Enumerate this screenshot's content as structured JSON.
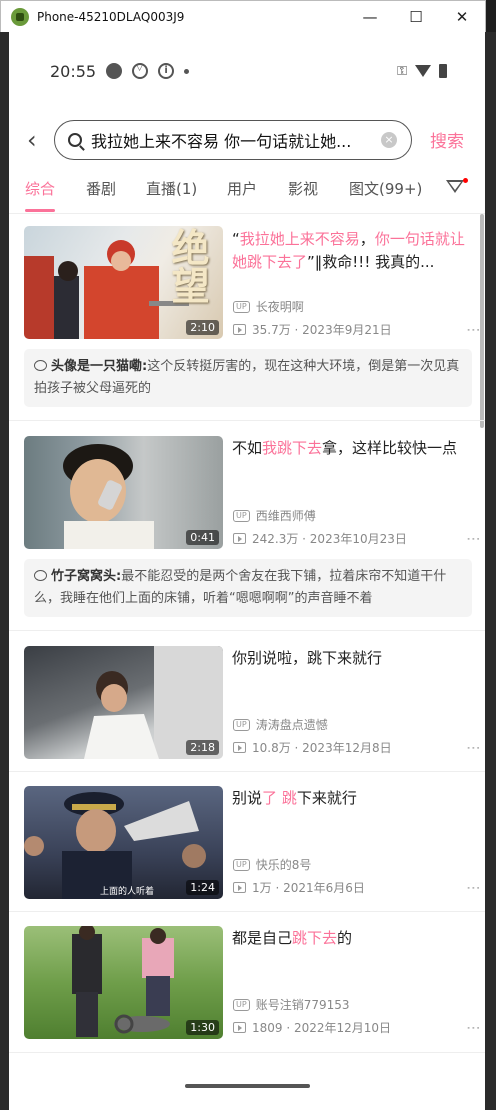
{
  "window": {
    "title": "Phone-45210DLAQ003J9",
    "minimize": "—",
    "maximize": "☐",
    "close": "✕"
  },
  "status": {
    "time": "20:55",
    "key": "⚿"
  },
  "search": {
    "back": "‹",
    "query": "我拉她上来不容易 你一句话就让她...",
    "clear": "×",
    "button": "搜索"
  },
  "tabs": [
    "综合",
    "番剧",
    "直播(1)",
    "用户",
    "影视",
    "图文(99+)"
  ],
  "videos": [
    {
      "title_parts": [
        {
          "t": "“",
          "h": false
        },
        {
          "t": "我拉她上来不容易",
          "h": true
        },
        {
          "t": "，",
          "h": false
        },
        {
          "t": "你一句话就让她跳下去了",
          "h": true
        },
        {
          "t": "”‖救命!!! 我真的...",
          "h": false
        }
      ],
      "duration": "2:10",
      "uploader": "长夜明啊",
      "stats": "35.7万 · 2023年9月21日",
      "comment": {
        "user": "头像是一只猫嘞:",
        "text": "这个反转挺厉害的，现在这种大环境，倒是第一次见真拍孩子被父母逼死的"
      }
    },
    {
      "title_parts": [
        {
          "t": "不如",
          "h": false
        },
        {
          "t": "我跳下去",
          "h": true
        },
        {
          "t": "拿，这样比较快一点",
          "h": false
        }
      ],
      "duration": "0:41",
      "uploader": "西维西师傅",
      "stats": "242.3万 · 2023年10月23日",
      "comment": {
        "user": "竹子窝窝头:",
        "text": "最不能忍受的是两个舍友在我下铺，拉着床帘不知道干什么，我睡在他们上面的床铺，听着“嗯嗯啊啊”的声音睡不着"
      }
    },
    {
      "title_parts": [
        {
          "t": "你别说啦，跳下来就行",
          "h": false
        }
      ],
      "duration": "2:18",
      "uploader": "涛涛盘点遗憾",
      "stats": "10.8万 · 2023年12月8日"
    },
    {
      "title_parts": [
        {
          "t": "别说",
          "h": false
        },
        {
          "t": "了",
          "h": true
        },
        {
          "t": " ",
          "h": false
        },
        {
          "t": "跳",
          "h": true
        },
        {
          "t": "下来就行",
          "h": false
        }
      ],
      "duration": "1:24",
      "uploader": "快乐的8号",
      "stats": "1万 · 2021年6月6日",
      "thumb_caption": "上面的人听着"
    },
    {
      "title_parts": [
        {
          "t": "都是自己",
          "h": false
        },
        {
          "t": "跳下去",
          "h": true
        },
        {
          "t": "的",
          "h": false
        }
      ],
      "duration": "1:30",
      "uploader": "账号注销779153",
      "stats": "1809 · 2022年12月10日"
    }
  ],
  "thumb1_text": "绝望",
  "labels": {
    "up": "UP",
    "more": "⋮"
  },
  "colors": {
    "accent": "#fb7299"
  }
}
